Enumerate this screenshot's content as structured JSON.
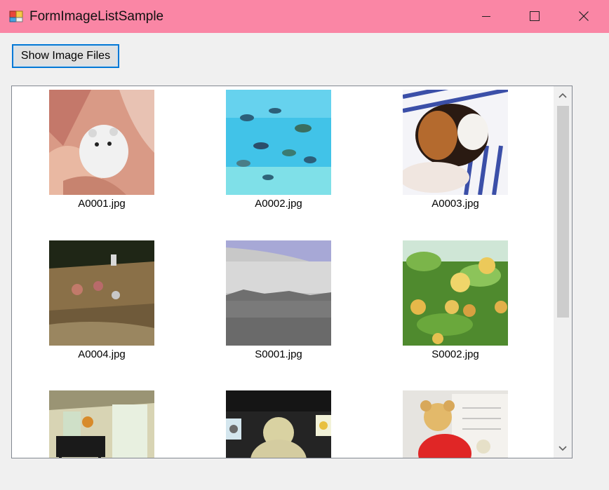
{
  "window": {
    "title": "FormImageListSample",
    "app_icon": "winforms-app-icon",
    "titlebar_color": "#fa86a5",
    "controls": [
      "minimize-icon",
      "maximize-icon",
      "close-icon"
    ]
  },
  "toolbar": {
    "show_button_label": "Show Image Files"
  },
  "listview": {
    "items": [
      {
        "label": "A0001.jpg",
        "thumbnail": "hamster-in-hands"
      },
      {
        "label": "A0002.jpg",
        "thumbnail": "fish-underwater"
      },
      {
        "label": "A0003.jpg",
        "thumbnail": "guinea-pig"
      },
      {
        "label": "A0004.jpg",
        "thumbnail": "rocky-stream"
      },
      {
        "label": "S0001.jpg",
        "thumbnail": "lake-landscape"
      },
      {
        "label": "S0002.jpg",
        "thumbnail": "fruit-tree"
      },
      {
        "label": "",
        "thumbnail": "room-with-piano"
      },
      {
        "label": "",
        "thumbnail": "stuffed-turtle"
      },
      {
        "label": "",
        "thumbnail": "teddy-bear"
      }
    ]
  }
}
